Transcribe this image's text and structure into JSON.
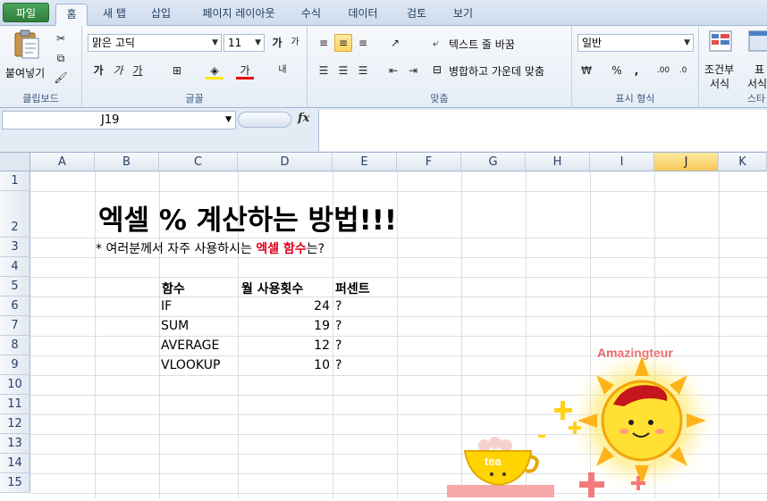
{
  "tabs": [
    "파일",
    "홈",
    "새 탭",
    "삽입",
    "페이지 레이아웃",
    "수식",
    "데이터",
    "검토",
    "보기"
  ],
  "ribbon": {
    "clipboard": {
      "paste_label": "붙여넣기",
      "group_label": "클립보드"
    },
    "font": {
      "font_name": "맑은 고딕",
      "font_size": "11",
      "group_label": "글꼴"
    },
    "align": {
      "wrap_text": "텍스트 줄 바꿈",
      "merge_center": "병합하고 가운데 맞춤",
      "group_label": "맞춤"
    },
    "number": {
      "format": "일반",
      "group_label": "표시 형식",
      "percent": "%",
      "comma": ","
    },
    "styles": {
      "cond_format_line1": "조건부",
      "cond_format_line2": "서식",
      "table_line1": "표",
      "table_line2": "서식",
      "group_label": "스타"
    }
  },
  "formula_bar": {
    "name_box": "J19",
    "fx": "fx",
    "formula": ""
  },
  "columns": [
    "A",
    "B",
    "C",
    "D",
    "E",
    "F",
    "G",
    "H",
    "I",
    "J",
    "K"
  ],
  "active_column": "J",
  "rows": [
    "1",
    "2",
    "3",
    "4",
    "5",
    "6",
    "7",
    "8",
    "9",
    "10",
    "11",
    "12",
    "13",
    "14",
    "15"
  ],
  "sheet": {
    "title": "엑셀 % 계산하는 방법!!!",
    "subtitle_prefix": "* 여러분께서 자주 사용하시는 ",
    "subtitle_highlight": "엑셀 함수",
    "subtitle_suffix": "는?",
    "table_headers": [
      "함수",
      "월 사용횟수",
      "퍼센트"
    ],
    "table_rows": [
      {
        "func": "IF",
        "count": "24",
        "percent": "?"
      },
      {
        "func": "SUM",
        "count": "19",
        "percent": "?"
      },
      {
        "func": "AVERAGE",
        "count": "12",
        "percent": "?"
      },
      {
        "func": "VLOOKUP",
        "count": "10",
        "percent": "?"
      }
    ]
  },
  "decoration": {
    "brand": "Amazingteur",
    "cup_text": "tea"
  },
  "colors": {
    "accent_red": "#e1001a",
    "file_tab": "#2f7d3c",
    "active_col": "#f7c75a"
  }
}
